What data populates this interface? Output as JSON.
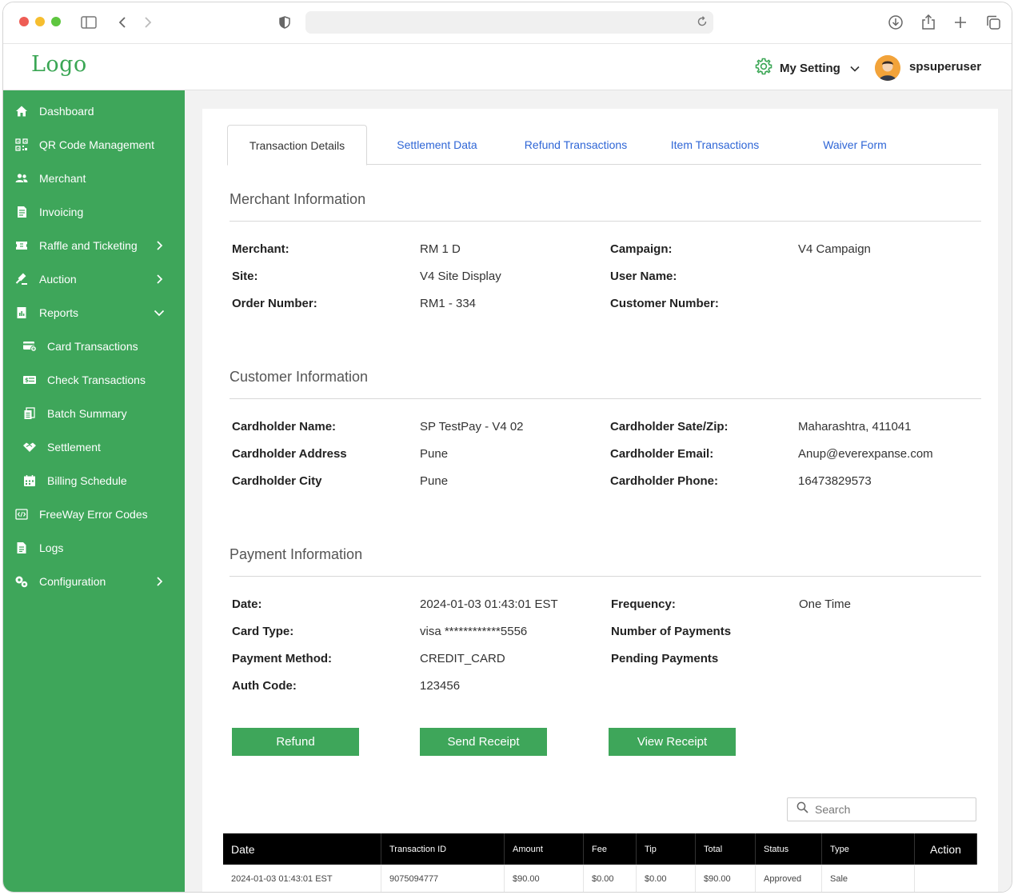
{
  "header": {
    "logo": "Logo",
    "settings_label": "My Setting",
    "username": "spsuperuser"
  },
  "sidebar": {
    "items": [
      {
        "label": "Dashboard",
        "icon": "home-icon"
      },
      {
        "label": "QR Code Management",
        "icon": "qr-code-icon"
      },
      {
        "label": "Merchant",
        "icon": "users-icon"
      },
      {
        "label": "Invoicing",
        "icon": "invoice-icon"
      },
      {
        "label": "Raffle and Ticketing",
        "icon": "ticket-icon"
      },
      {
        "label": "Auction",
        "icon": "gavel-icon"
      },
      {
        "label": "Reports",
        "icon": "report-icon"
      },
      {
        "label": "Card Transactions",
        "icon": "card-icon"
      },
      {
        "label": "Check Transactions",
        "icon": "check-icon"
      },
      {
        "label": "Batch Summary",
        "icon": "batch-icon"
      },
      {
        "label": "Settlement",
        "icon": "handshake-icon"
      },
      {
        "label": "Billing Schedule",
        "icon": "calendar-icon"
      },
      {
        "label": "FreeWay Error Codes",
        "icon": "code-icon"
      },
      {
        "label": "Logs",
        "icon": "file-icon"
      },
      {
        "label": "Configuration",
        "icon": "config-icon"
      }
    ]
  },
  "tabs": [
    "Transaction Details",
    "Settlement Data",
    "Refund Transactions",
    "Item Transactions",
    "Waiver Form"
  ],
  "merchant_info": {
    "title": "Merchant Information",
    "merchant_label": "Merchant:",
    "merchant": "RM 1 D",
    "campaign_label": "Campaign:",
    "campaign": "V4 Campaign",
    "site_label": "Site:",
    "site": "V4 Site Display",
    "user_name_label": "User Name:",
    "user_name": "",
    "order_number_label": "Order Number:",
    "order_number": "RM1 - 334",
    "customer_number_label": "Customer Number:",
    "customer_number": ""
  },
  "customer_info": {
    "title": "Customer Information",
    "name_label": "Cardholder Name:",
    "name": "SP TestPay - V4 02",
    "state_zip_label": "Cardholder Sate/Zip:",
    "state_zip": "Maharashtra, 411041",
    "address_label": "Cardholder Address",
    "address": "Pune",
    "email_label": "Cardholder Email:",
    "email": "Anup@everexpanse.com",
    "city_label": "Cardholder City",
    "city": "Pune",
    "phone_label": "Cardholder Phone:",
    "phone": "16473829573"
  },
  "payment_info": {
    "title": "Payment Information",
    "date_label": "Date:",
    "date": "2024-01-03 01:43:01 EST",
    "frequency_label": "Frequency:",
    "frequency": "One Time",
    "card_type_label": "Card Type:",
    "card_type": "visa ************5556",
    "num_payments_label": "Number of Payments",
    "num_payments": "",
    "method_label": "Payment Method:",
    "method": "CREDIT_CARD",
    "pending_label": "Pending Payments",
    "pending": "",
    "auth_label": "Auth Code:",
    "auth": "123456"
  },
  "actions": {
    "refund": "Refund",
    "send_receipt": "Send Receipt",
    "view_receipt": "View Receipt"
  },
  "search": {
    "placeholder": "Search"
  },
  "table": {
    "columns": [
      "Date",
      "Transaction ID",
      "Amount",
      "Fee",
      "Tip",
      "Total",
      "Status",
      "Type",
      "Action"
    ],
    "rows": [
      [
        "2024-01-03 01:43:01 EST",
        "9075094777",
        "$90.00",
        "$0.00",
        "$0.00",
        "$90.00",
        "Approved",
        "Sale",
        ""
      ]
    ]
  },
  "colors": {
    "sidebar": "#3ea65a",
    "accent": "#3aa654",
    "tab_link": "#2f66d6",
    "table_header": "#000000"
  }
}
